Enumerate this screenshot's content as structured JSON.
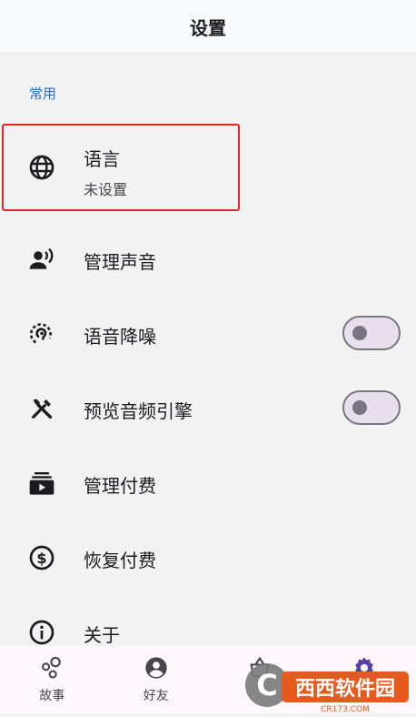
{
  "header": {
    "title": "设置"
  },
  "section": {
    "title": "常用"
  },
  "items": [
    {
      "label": "语言",
      "sublabel": "未设置",
      "icon": "globe-icon"
    },
    {
      "label": "管理声音",
      "icon": "voice-person-icon"
    },
    {
      "label": "语音降噪",
      "icon": "noise-reduction-icon",
      "toggle": false
    },
    {
      "label": "预览音频引擎",
      "icon": "tools-icon",
      "toggle": false
    },
    {
      "label": "管理付费",
      "icon": "subscriptions-icon"
    },
    {
      "label": "恢复付费",
      "icon": "dollar-circle-icon"
    },
    {
      "label": "关于",
      "icon": "info-icon"
    }
  ],
  "nav": [
    {
      "label": "故事",
      "icon": "bubbles-icon"
    },
    {
      "label": "好友",
      "icon": "account-circle-icon"
    },
    {
      "label": "",
      "icon": "basket-icon"
    },
    {
      "label": "",
      "icon": "gear-icon"
    }
  ],
  "watermark": {
    "text": "西西软件园",
    "sub": "CR173.COM"
  },
  "colors": {
    "accent": "#2c6bbf",
    "highlight": "#e2252b",
    "watermark": "#e65a1e"
  }
}
